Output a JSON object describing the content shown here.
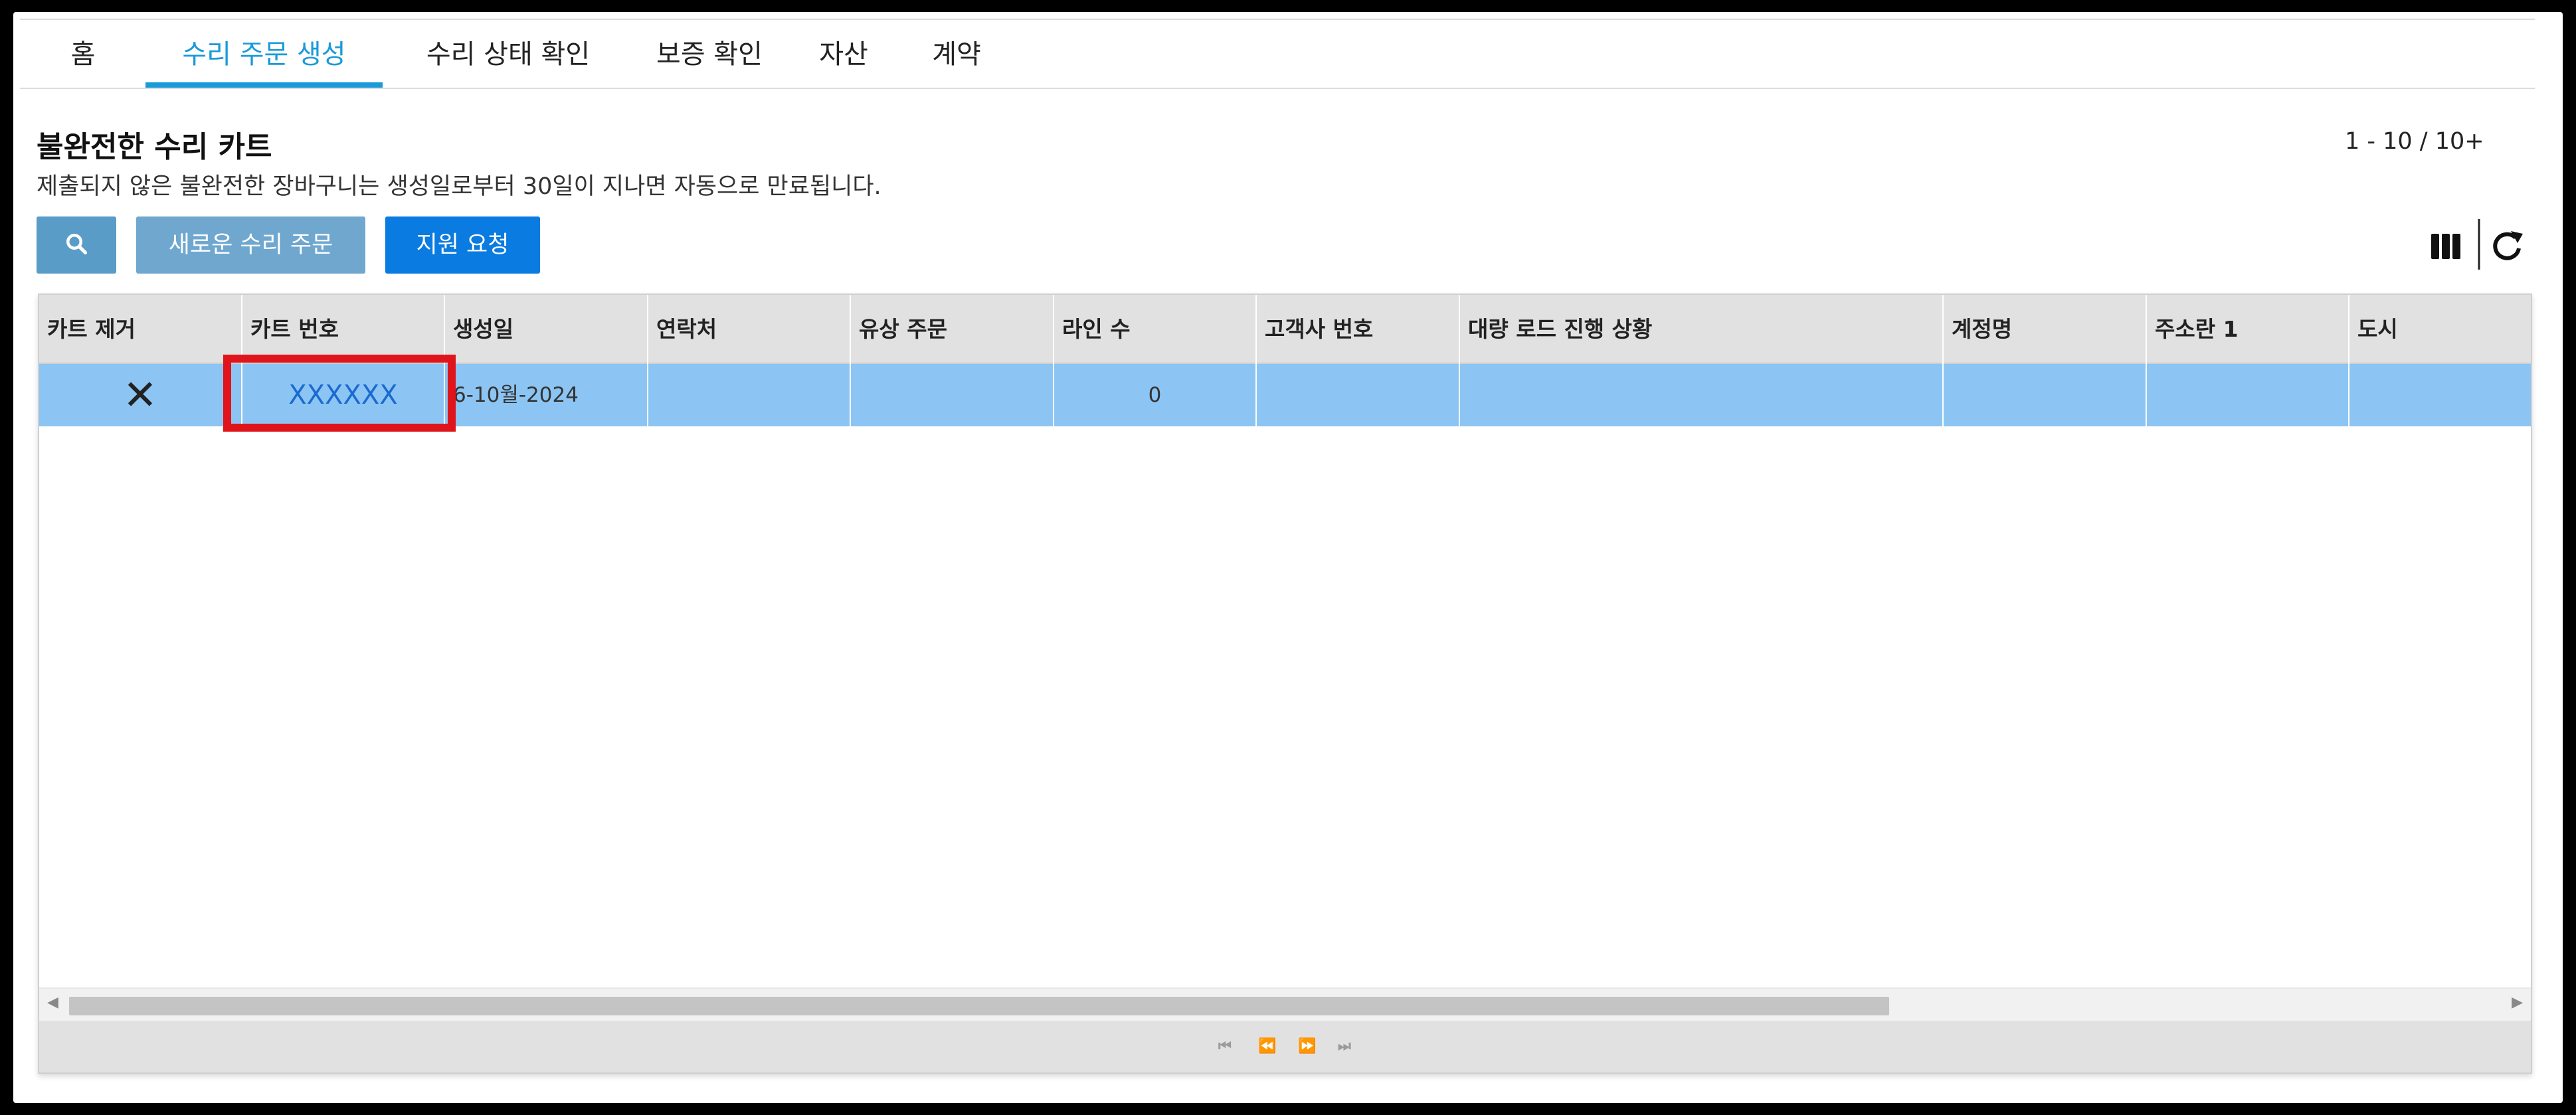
{
  "nav": {
    "items": [
      {
        "label": "홈"
      },
      {
        "label": "수리 주문 생성"
      },
      {
        "label": "수리 상태 확인"
      },
      {
        "label": "보증 확인"
      },
      {
        "label": "자산"
      },
      {
        "label": "계약"
      }
    ],
    "active_index": 1
  },
  "header": {
    "title": "불완전한 수리 카트",
    "description": "제출되지 않은 불완전한 장바구니는 생성일로부터 30일이 지나면 자동으로 만료됩니다.",
    "pager_count": "1 - 10 / 10+"
  },
  "toolbar": {
    "search_icon": "search-icon",
    "new_order_label": "새로운 수리 주문",
    "support_label": "지원 요청",
    "columns_icon": "columns-icon",
    "refresh_icon": "refresh-icon"
  },
  "grid": {
    "columns": [
      "카트 제거",
      "카트 번호",
      "생성일",
      "연락처",
      "유상 주문",
      "라인 수",
      "고객사 번호",
      "대량 로드 진행 상황",
      "계정명",
      "주소란 1",
      "도시"
    ],
    "rows": [
      {
        "remove": "✕",
        "cart_number": "XXXXXX",
        "created": "6-10월-2024",
        "contact": "",
        "paid_order": "",
        "line_count": "0",
        "customer_number": "",
        "bulk_progress": "",
        "account_name": "",
        "address1": "",
        "city": ""
      }
    ]
  },
  "colors": {
    "accent": "#1a9ad9",
    "row_selected": "#8cc5f3",
    "highlight_box": "#e0141b",
    "support_button": "#0a7be0"
  }
}
